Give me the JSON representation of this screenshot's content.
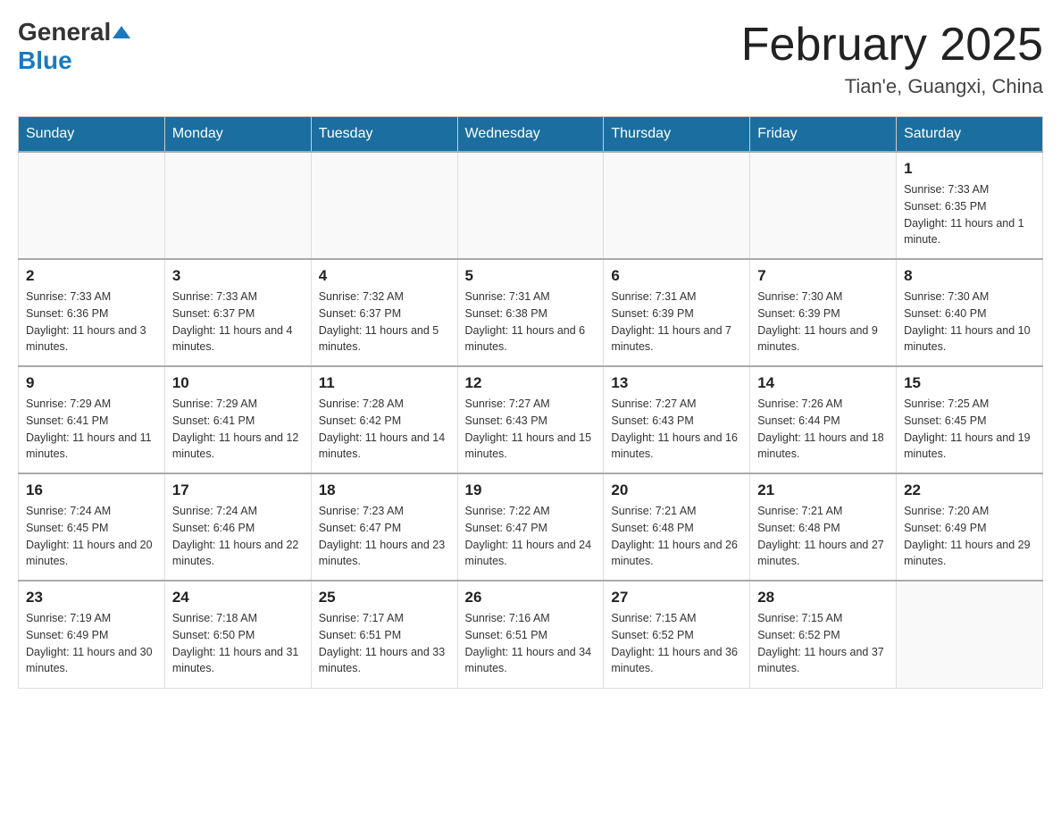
{
  "header": {
    "logo_general": "General",
    "logo_blue": "Blue",
    "month_title": "February 2025",
    "location": "Tian'e, Guangxi, China"
  },
  "days_of_week": [
    "Sunday",
    "Monday",
    "Tuesday",
    "Wednesday",
    "Thursday",
    "Friday",
    "Saturday"
  ],
  "weeks": [
    [
      {
        "day": "",
        "info": ""
      },
      {
        "day": "",
        "info": ""
      },
      {
        "day": "",
        "info": ""
      },
      {
        "day": "",
        "info": ""
      },
      {
        "day": "",
        "info": ""
      },
      {
        "day": "",
        "info": ""
      },
      {
        "day": "1",
        "info": "Sunrise: 7:33 AM\nSunset: 6:35 PM\nDaylight: 11 hours and 1 minute."
      }
    ],
    [
      {
        "day": "2",
        "info": "Sunrise: 7:33 AM\nSunset: 6:36 PM\nDaylight: 11 hours and 3 minutes."
      },
      {
        "day": "3",
        "info": "Sunrise: 7:33 AM\nSunset: 6:37 PM\nDaylight: 11 hours and 4 minutes."
      },
      {
        "day": "4",
        "info": "Sunrise: 7:32 AM\nSunset: 6:37 PM\nDaylight: 11 hours and 5 minutes."
      },
      {
        "day": "5",
        "info": "Sunrise: 7:31 AM\nSunset: 6:38 PM\nDaylight: 11 hours and 6 minutes."
      },
      {
        "day": "6",
        "info": "Sunrise: 7:31 AM\nSunset: 6:39 PM\nDaylight: 11 hours and 7 minutes."
      },
      {
        "day": "7",
        "info": "Sunrise: 7:30 AM\nSunset: 6:39 PM\nDaylight: 11 hours and 9 minutes."
      },
      {
        "day": "8",
        "info": "Sunrise: 7:30 AM\nSunset: 6:40 PM\nDaylight: 11 hours and 10 minutes."
      }
    ],
    [
      {
        "day": "9",
        "info": "Sunrise: 7:29 AM\nSunset: 6:41 PM\nDaylight: 11 hours and 11 minutes."
      },
      {
        "day": "10",
        "info": "Sunrise: 7:29 AM\nSunset: 6:41 PM\nDaylight: 11 hours and 12 minutes."
      },
      {
        "day": "11",
        "info": "Sunrise: 7:28 AM\nSunset: 6:42 PM\nDaylight: 11 hours and 14 minutes."
      },
      {
        "day": "12",
        "info": "Sunrise: 7:27 AM\nSunset: 6:43 PM\nDaylight: 11 hours and 15 minutes."
      },
      {
        "day": "13",
        "info": "Sunrise: 7:27 AM\nSunset: 6:43 PM\nDaylight: 11 hours and 16 minutes."
      },
      {
        "day": "14",
        "info": "Sunrise: 7:26 AM\nSunset: 6:44 PM\nDaylight: 11 hours and 18 minutes."
      },
      {
        "day": "15",
        "info": "Sunrise: 7:25 AM\nSunset: 6:45 PM\nDaylight: 11 hours and 19 minutes."
      }
    ],
    [
      {
        "day": "16",
        "info": "Sunrise: 7:24 AM\nSunset: 6:45 PM\nDaylight: 11 hours and 20 minutes."
      },
      {
        "day": "17",
        "info": "Sunrise: 7:24 AM\nSunset: 6:46 PM\nDaylight: 11 hours and 22 minutes."
      },
      {
        "day": "18",
        "info": "Sunrise: 7:23 AM\nSunset: 6:47 PM\nDaylight: 11 hours and 23 minutes."
      },
      {
        "day": "19",
        "info": "Sunrise: 7:22 AM\nSunset: 6:47 PM\nDaylight: 11 hours and 24 minutes."
      },
      {
        "day": "20",
        "info": "Sunrise: 7:21 AM\nSunset: 6:48 PM\nDaylight: 11 hours and 26 minutes."
      },
      {
        "day": "21",
        "info": "Sunrise: 7:21 AM\nSunset: 6:48 PM\nDaylight: 11 hours and 27 minutes."
      },
      {
        "day": "22",
        "info": "Sunrise: 7:20 AM\nSunset: 6:49 PM\nDaylight: 11 hours and 29 minutes."
      }
    ],
    [
      {
        "day": "23",
        "info": "Sunrise: 7:19 AM\nSunset: 6:49 PM\nDaylight: 11 hours and 30 minutes."
      },
      {
        "day": "24",
        "info": "Sunrise: 7:18 AM\nSunset: 6:50 PM\nDaylight: 11 hours and 31 minutes."
      },
      {
        "day": "25",
        "info": "Sunrise: 7:17 AM\nSunset: 6:51 PM\nDaylight: 11 hours and 33 minutes."
      },
      {
        "day": "26",
        "info": "Sunrise: 7:16 AM\nSunset: 6:51 PM\nDaylight: 11 hours and 34 minutes."
      },
      {
        "day": "27",
        "info": "Sunrise: 7:15 AM\nSunset: 6:52 PM\nDaylight: 11 hours and 36 minutes."
      },
      {
        "day": "28",
        "info": "Sunrise: 7:15 AM\nSunset: 6:52 PM\nDaylight: 11 hours and 37 minutes."
      },
      {
        "day": "",
        "info": ""
      }
    ]
  ]
}
